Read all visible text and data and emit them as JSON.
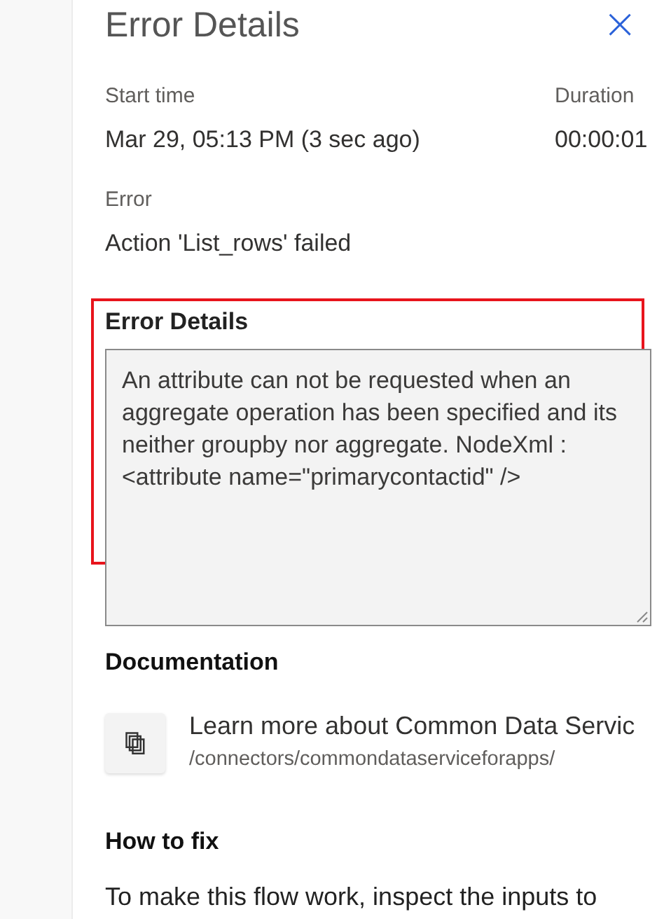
{
  "panel": {
    "title": "Error Details",
    "close_icon": "×"
  },
  "fields": [
    {
      "label": "Start time",
      "value": "Mar 29, 05:13 PM (3 sec ago)"
    },
    {
      "label": "Duration",
      "value": "00:00:01"
    }
  ],
  "error": {
    "label": "Error",
    "value": "Action 'List_rows' failed"
  },
  "error_details": {
    "heading": "Error Details",
    "text": "An attribute can not be requested when an aggregate operation has been specified and its neither groupby nor aggregate. NodeXml : <attribute name=\"primarycontactid\" />",
    "highlighted": true
  },
  "documentation": {
    "heading": "Documentation",
    "link": "Learn more about Common Data Servic",
    "url": "/connectors/commondataserviceforapps/"
  },
  "how_to_fix": {
    "heading": "How to fix",
    "text": "To make this flow work, inspect the inputs to"
  }
}
